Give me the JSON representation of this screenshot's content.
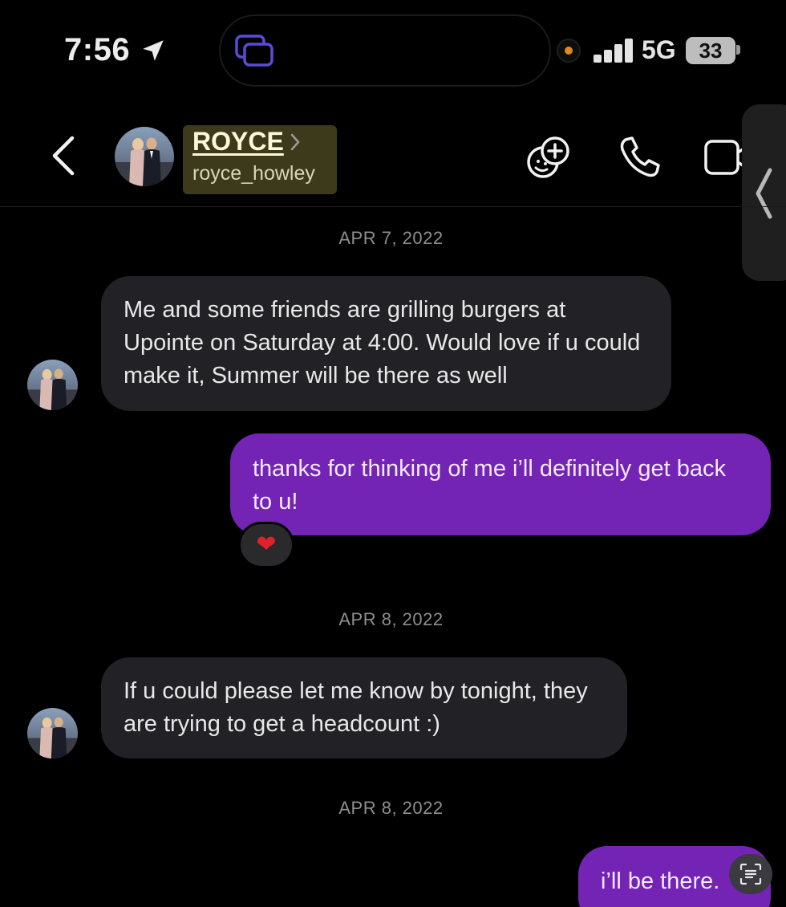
{
  "status_bar": {
    "time": "7:56",
    "network": "5G",
    "battery": "33",
    "icons": [
      "location-arrow-icon",
      "screen-share-icon",
      "recording-dot-icon",
      "signal-bars-icon"
    ]
  },
  "header": {
    "contact_name": "ROYCE",
    "contact_username": "royce_howley",
    "icons": [
      "back-chevron-icon",
      "name-chevron-icon",
      "add-sticker-icon",
      "phone-icon",
      "video-icon",
      "side-panel-chevron-icon"
    ]
  },
  "messages": [
    {
      "type": "date",
      "text": "APR 7, 2022"
    },
    {
      "type": "incoming",
      "text": "Me and some friends are grilling burgers at Upointe on Saturday at 4:00. Would love if u could make it, Summer will be there as well"
    },
    {
      "type": "outgoing",
      "text": "thanks for thinking of me i’ll definitely get back to u!",
      "reaction": "❤"
    },
    {
      "type": "date",
      "text": "APR 8, 2022"
    },
    {
      "type": "incoming",
      "text": "If u could please let me know by tonight, they are trying to get a headcount :)"
    },
    {
      "type": "date",
      "text": "APR 8, 2022"
    },
    {
      "type": "outgoing",
      "text": "i’ll be there."
    }
  ],
  "colors": {
    "background": "#000000",
    "incoming_bubble": "#222226",
    "outgoing_bubble": "#7424b5",
    "date_text": "#8e8e8e",
    "name_highlight": "#3d3a1c"
  }
}
